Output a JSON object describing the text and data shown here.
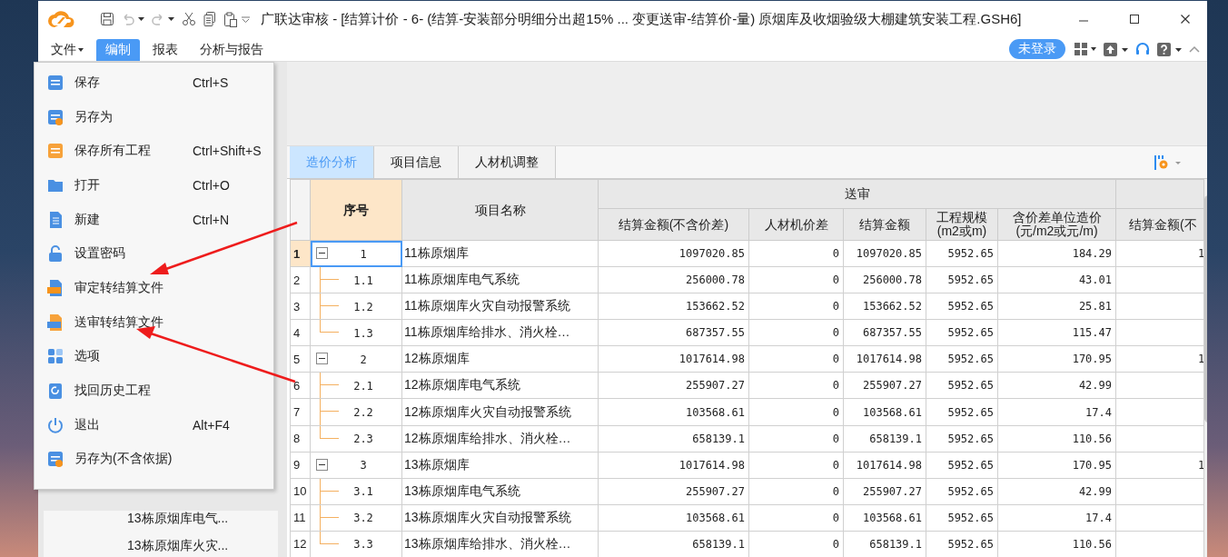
{
  "window": {
    "title": "广联达审核 - [结算计价 - 6-  (结算-安装部分明细分出超15% ...  变更送审-结算价-量)  原烟库及收烟验级大棚建筑安装工程.GSH6]"
  },
  "menu_bar": [
    {
      "label": "文件",
      "selected": false,
      "has_caret": true
    },
    {
      "label": "编制",
      "selected": true,
      "has_caret": false
    },
    {
      "label": "报表",
      "selected": false,
      "has_caret": false
    },
    {
      "label": "分析与报告",
      "selected": false,
      "has_caret": false
    }
  ],
  "login_badge": "未登录",
  "file_menu": [
    {
      "label": "保存",
      "shortcut": "Ctrl+S"
    },
    {
      "label": "另存为"
    },
    {
      "label": "保存所有工程",
      "shortcut": "Ctrl+Shift+S"
    },
    {
      "label": "打开",
      "shortcut": "Ctrl+O"
    },
    {
      "label": "新建",
      "shortcut": "Ctrl+N"
    },
    {
      "label": "设置密码"
    },
    {
      "label": "审定转结算文件"
    },
    {
      "label": "送审转结算文件"
    },
    {
      "label": "选项"
    },
    {
      "label": "找回历史工程"
    },
    {
      "label": "退出",
      "shortcut": "Alt+F4"
    },
    {
      "label": "另存为(不含依据)"
    }
  ],
  "sidebar": {
    "items": [
      "13栋原烟库电气...",
      "13栋原烟库火灾..."
    ]
  },
  "tabs": [
    {
      "label": "造价分析",
      "selected": true
    },
    {
      "label": "项目信息",
      "selected": false
    },
    {
      "label": "人材机调整",
      "selected": false
    }
  ],
  "table": {
    "group_header": "送审",
    "columns": [
      "序号",
      "项目名称",
      "结算金额(不含价差)",
      "人材机价差",
      "结算金额",
      "工程规模\n(m2或m)",
      "含价差单位造价\n(元/m2或元/m)",
      "结算金额(不"
    ],
    "rows": [
      {
        "row_number": "1",
        "code": "1",
        "name": "11栋原烟库",
        "amount_excl": "1097020.85",
        "diff": "0",
        "amount": "1097020.85",
        "scale": "5952.65",
        "unit_cost": "184.29",
        "column_9": "1",
        "expanded": true,
        "selected": true,
        "children": [
          {
            "row_number": "2",
            "code": "1.1",
            "name": "11栋原烟库电气系统",
            "amount_excl": "256000.78",
            "diff": "0",
            "amount": "256000.78",
            "scale": "5952.65",
            "unit_cost": "43.01",
            "selected": false
          },
          {
            "row_number": "3",
            "code": "1.2",
            "name": "11栋原烟库火灾自动报警系统",
            "amount_excl": "153662.52",
            "diff": "0",
            "amount": "153662.52",
            "scale": "5952.65",
            "unit_cost": "25.81",
            "selected": false
          },
          {
            "row_number": "4",
            "code": "1.3",
            "name": "11栋原烟库给排水、消火栓…",
            "amount_excl": "687357.55",
            "diff": "0",
            "amount": "687357.55",
            "scale": "5952.65",
            "unit_cost": "115.47",
            "selected": false
          }
        ]
      },
      {
        "row_number": "5",
        "code": "2",
        "name": "12栋原烟库",
        "amount_excl": "1017614.98",
        "diff": "0",
        "amount": "1017614.98",
        "scale": "5952.65",
        "unit_cost": "170.95",
        "column_9": "1",
        "expanded": true,
        "selected": false,
        "children": [
          {
            "row_number": "6",
            "code": "2.1",
            "name": "12栋原烟库电气系统",
            "amount_excl": "255907.27",
            "diff": "0",
            "amount": "255907.27",
            "scale": "5952.65",
            "unit_cost": "42.99",
            "selected": false
          },
          {
            "row_number": "7",
            "code": "2.2",
            "name": "12栋原烟库火灾自动报警系统",
            "amount_excl": "103568.61",
            "diff": "0",
            "amount": "103568.61",
            "scale": "5952.65",
            "unit_cost": "17.4",
            "selected": false
          },
          {
            "row_number": "8",
            "code": "2.3",
            "name": "12栋原烟库给排水、消火栓…",
            "amount_excl": "658139.1",
            "diff": "0",
            "amount": "658139.1",
            "scale": "5952.65",
            "unit_cost": "110.56",
            "selected": false
          }
        ]
      },
      {
        "row_number": "9",
        "code": "3",
        "name": "13栋原烟库",
        "amount_excl": "1017614.98",
        "diff": "0",
        "amount": "1017614.98",
        "scale": "5952.65",
        "unit_cost": "170.95",
        "column_9": "1",
        "expanded": true,
        "selected": false,
        "children": [
          {
            "row_number": "10",
            "code": "3.1",
            "name": "13栋原烟库电气系统",
            "amount_excl": "255907.27",
            "diff": "0",
            "amount": "255907.27",
            "scale": "5952.65",
            "unit_cost": "42.99",
            "selected": false
          },
          {
            "row_number": "11",
            "code": "3.2",
            "name": "13栋原烟库火灾自动报警系统",
            "amount_excl": "103568.61",
            "diff": "0",
            "amount": "103568.61",
            "scale": "5952.65",
            "unit_cost": "17.4",
            "selected": false
          },
          {
            "row_number": "12",
            "code": "3.3",
            "name": "13栋原烟库给排水、消火栓…",
            "amount_excl": "658139.1",
            "diff": "0",
            "amount": "658139.1",
            "scale": "5952.65",
            "unit_cost": "110.56",
            "selected": false
          }
        ]
      }
    ]
  }
}
